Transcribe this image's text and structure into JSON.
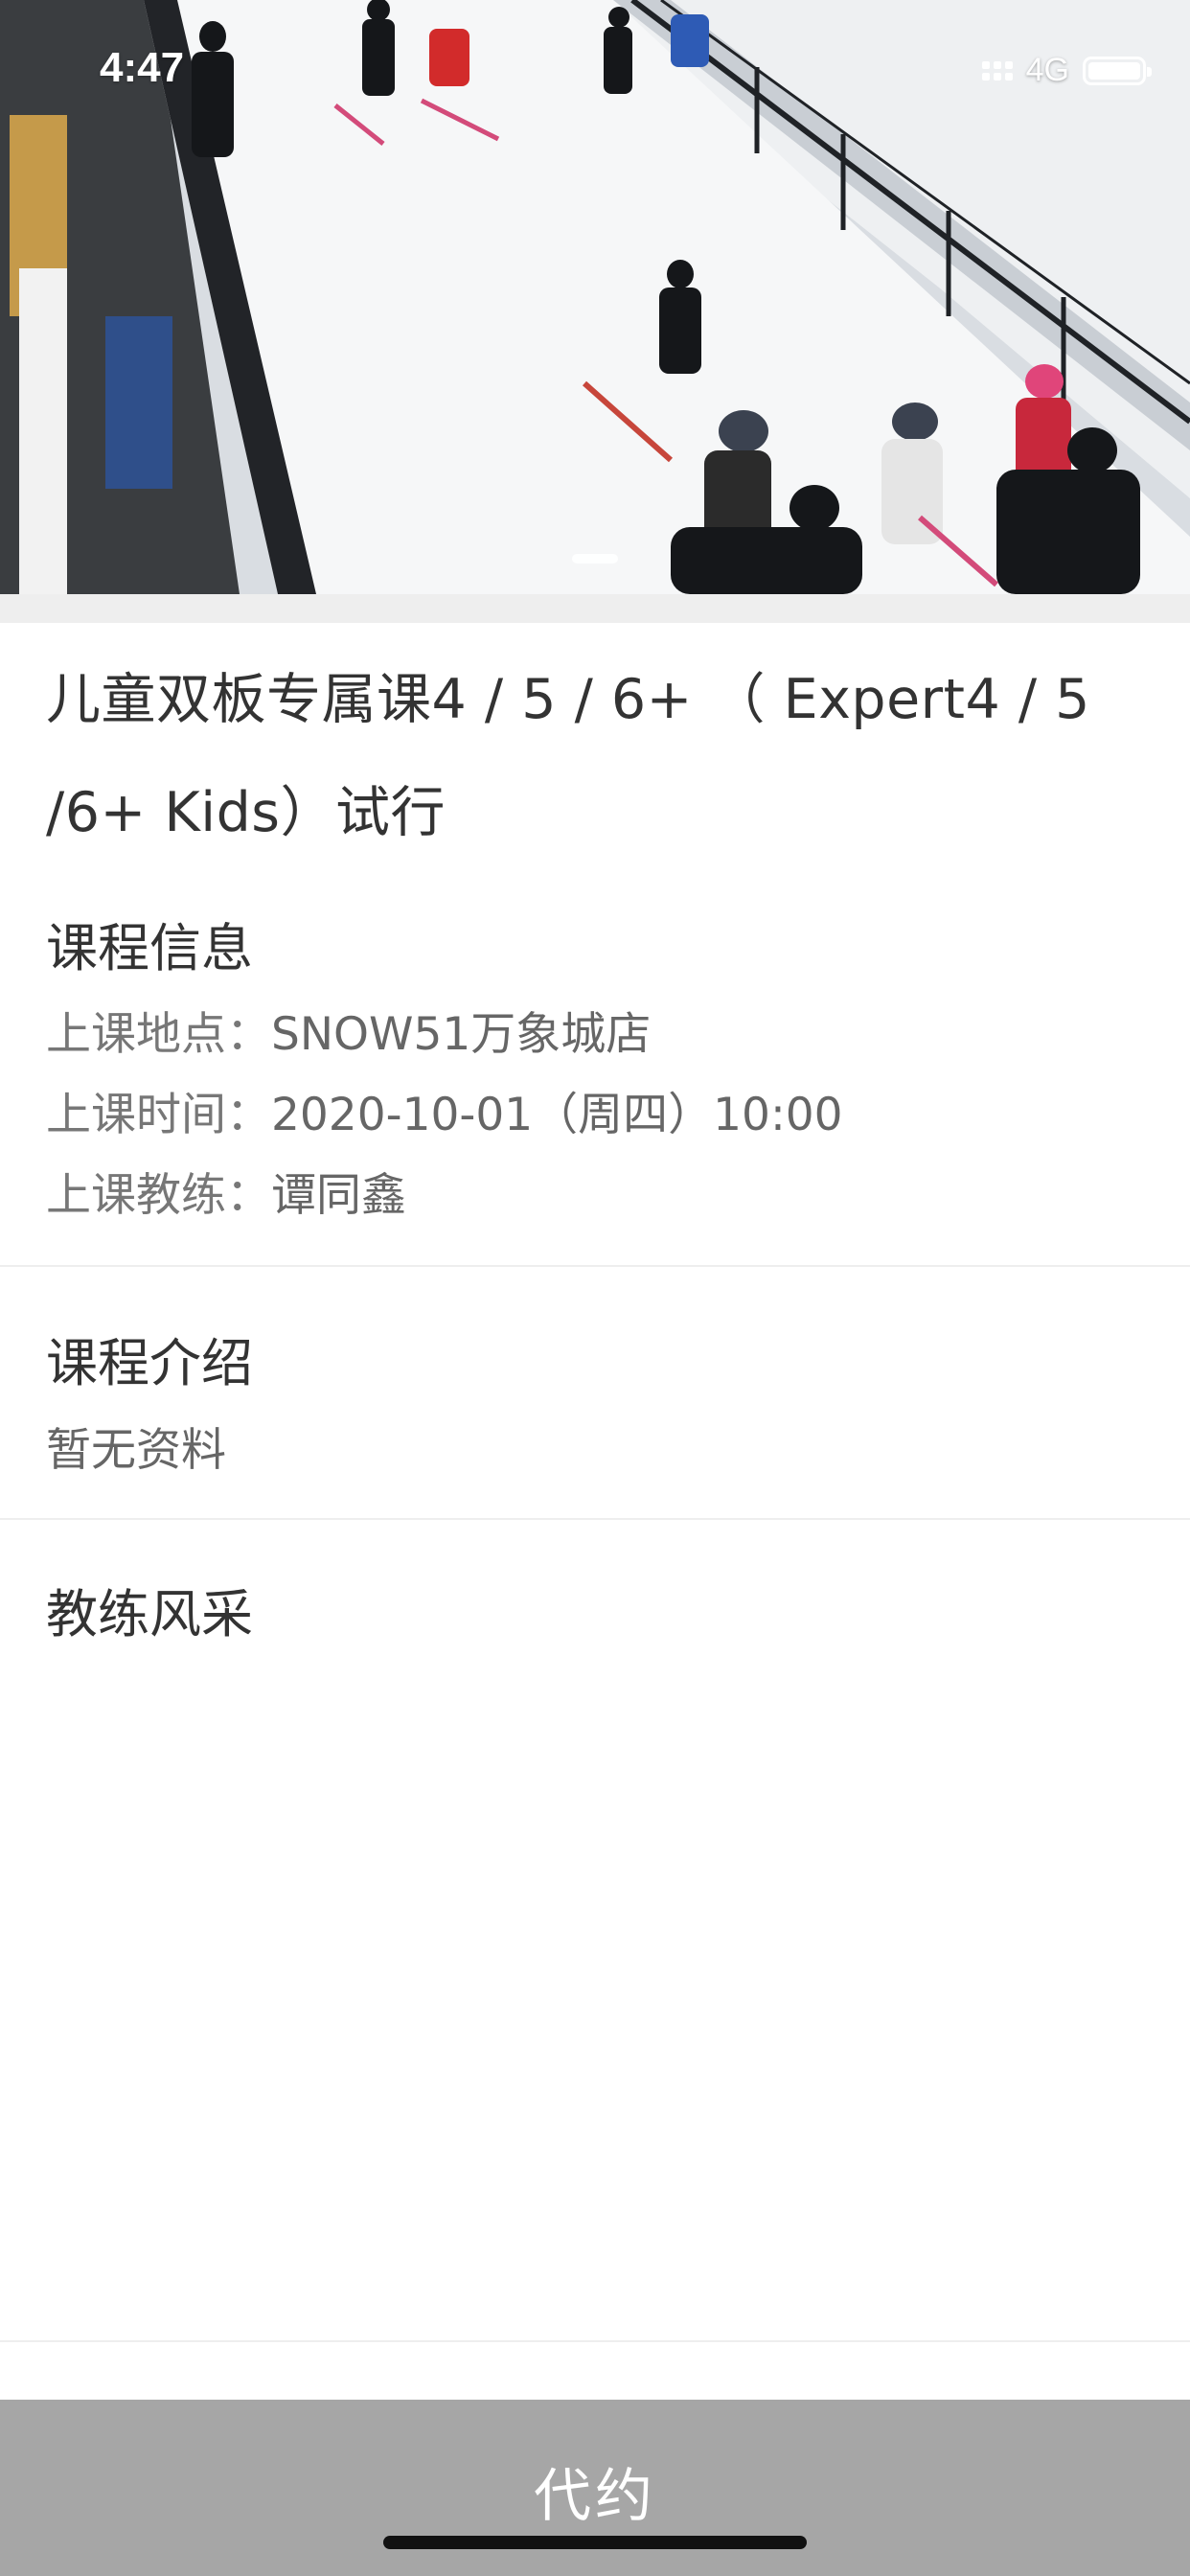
{
  "status_bar": {
    "time": "4:47",
    "network": "4G",
    "icons": [
      "signal-icon",
      "battery-icon"
    ]
  },
  "hero": {
    "image": "kids-ski-lesson-photo",
    "carousel": "page-indicator"
  },
  "course": {
    "title": "儿童双板专属课4 / 5 / 6+ （ Expert4 / 5 /6+ Kids）试行"
  },
  "info": {
    "heading": "课程信息",
    "location_label": "上课地点：",
    "location_value": "SNOW51万象城店",
    "time_label": "上课时间：",
    "time_value": "2020-10-01（周四）10:00",
    "coach_label": "上课教练：",
    "coach_value": "谭同鑫"
  },
  "intro": {
    "heading": "课程介绍",
    "text": "暂无资料"
  },
  "coach": {
    "heading": "教练风采"
  },
  "action": {
    "label": "代约"
  },
  "colors": {
    "text_primary": "#333333",
    "text_secondary": "#666666",
    "divider": "#eeeeee",
    "button_bg": "#a6a6a6",
    "button_text": "#ffffff"
  }
}
